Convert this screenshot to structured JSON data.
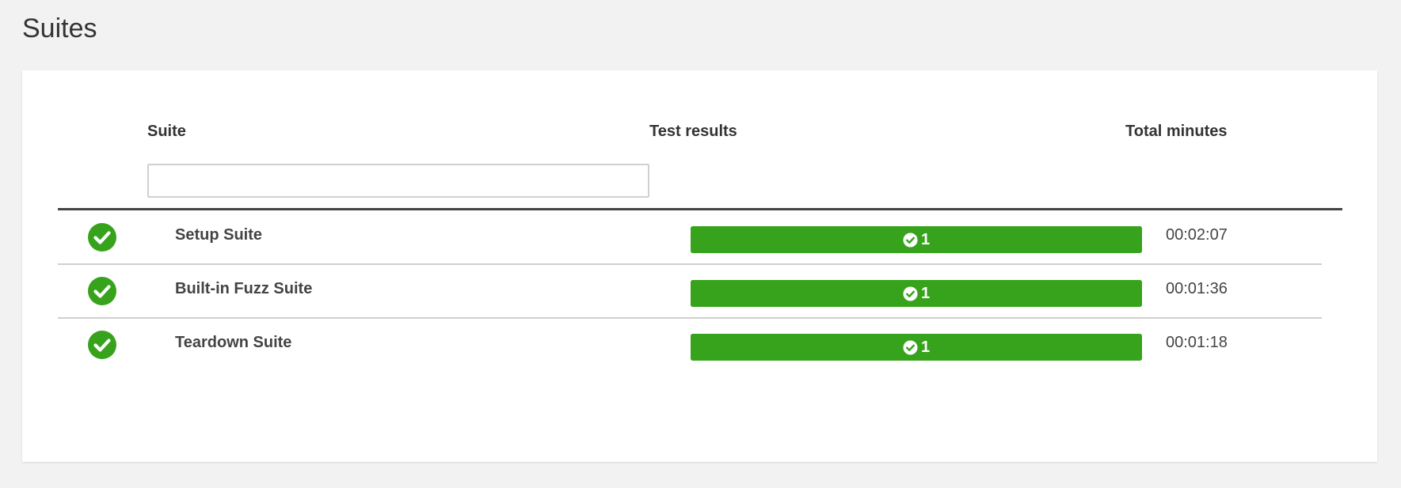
{
  "page": {
    "title": "Suites"
  },
  "table": {
    "headers": {
      "suite": "Suite",
      "results": "Test results",
      "minutes": "Total minutes"
    },
    "filter": {
      "value": "",
      "placeholder": ""
    },
    "rows": [
      {
        "status": "passed",
        "name": "Setup Suite",
        "passed_count": "1",
        "passed_fraction": 1.0,
        "duration": "00:02:07"
      },
      {
        "status": "passed",
        "name": "Built-in Fuzz Suite",
        "passed_count": "1",
        "passed_fraction": 1.0,
        "duration": "00:01:36"
      },
      {
        "status": "passed",
        "name": "Teardown Suite",
        "passed_count": "1",
        "passed_fraction": 1.0,
        "duration": "00:01:18"
      }
    ]
  },
  "icons": {
    "status": "check-circle-icon",
    "result": "check-circle-icon"
  },
  "colors": {
    "pass": "#37a31c",
    "background": "#f2f2f2",
    "card": "#ffffff",
    "text": "#333333"
  }
}
